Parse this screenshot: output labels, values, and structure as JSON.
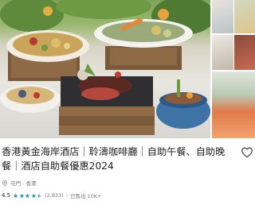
{
  "listing": {
    "title": "香港黃金海岸酒店｜聆濤咖啡廳｜自助午餐、自助晚餐｜酒店自助餐優惠2024",
    "location": "屯門 - 香港",
    "rating": "4.5",
    "rating_value": 4.5,
    "rating_max": 5,
    "reviews": "(2,833)",
    "booked": "已售出 10K+"
  },
  "icons": {
    "favorite": "heart-outline-icon",
    "location": "location-pin-icon",
    "star": "star-icon"
  },
  "colors": {
    "star": "#29a3ad",
    "text": "#212121",
    "muted": "#757575"
  }
}
